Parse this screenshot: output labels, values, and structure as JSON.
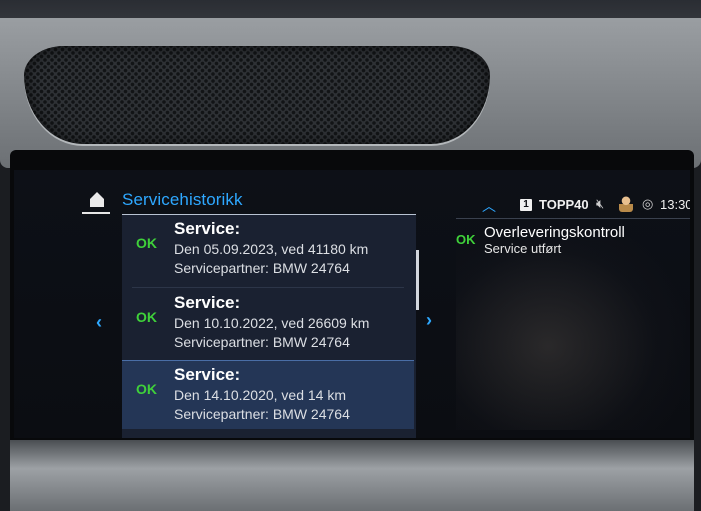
{
  "header": {
    "title": "Servicehistorikk"
  },
  "service_list": {
    "items": [
      {
        "status": "OK",
        "title": "Service:",
        "date_line": "Den 05.09.2023, ved 41180 km",
        "partner_line": "Servicepartner: BMW 24764",
        "selected": false
      },
      {
        "status": "OK",
        "title": "Service:",
        "date_line": "Den 10.10.2022, ved 26609 km",
        "partner_line": "Servicepartner: BMW 24764",
        "selected": false
      },
      {
        "status": "OK",
        "title": "Service:",
        "date_line": "Den 14.10.2020, ved 14 km",
        "partner_line": "Servicepartner: BMW 24764",
        "selected": true
      }
    ]
  },
  "status_bar": {
    "media_source_badge": "1",
    "station": "TOPP40",
    "clock": "13:30"
  },
  "detail": {
    "status": "OK",
    "title": "Overleveringskontroll",
    "subtitle": "Service utført"
  },
  "colors": {
    "accent": "#2ea8ff",
    "ok_green": "#3fd13a",
    "selected_row": "#243656",
    "panel_bg": "#1a2131"
  },
  "icons": {
    "home": "home-icon",
    "prev": "chevron-left-icon",
    "next": "chevron-right-icon",
    "collapse": "chevron-up-icon",
    "mute": "mute-icon",
    "driver": "driver-profile-icon",
    "connectivity": "connectivity-icon"
  }
}
